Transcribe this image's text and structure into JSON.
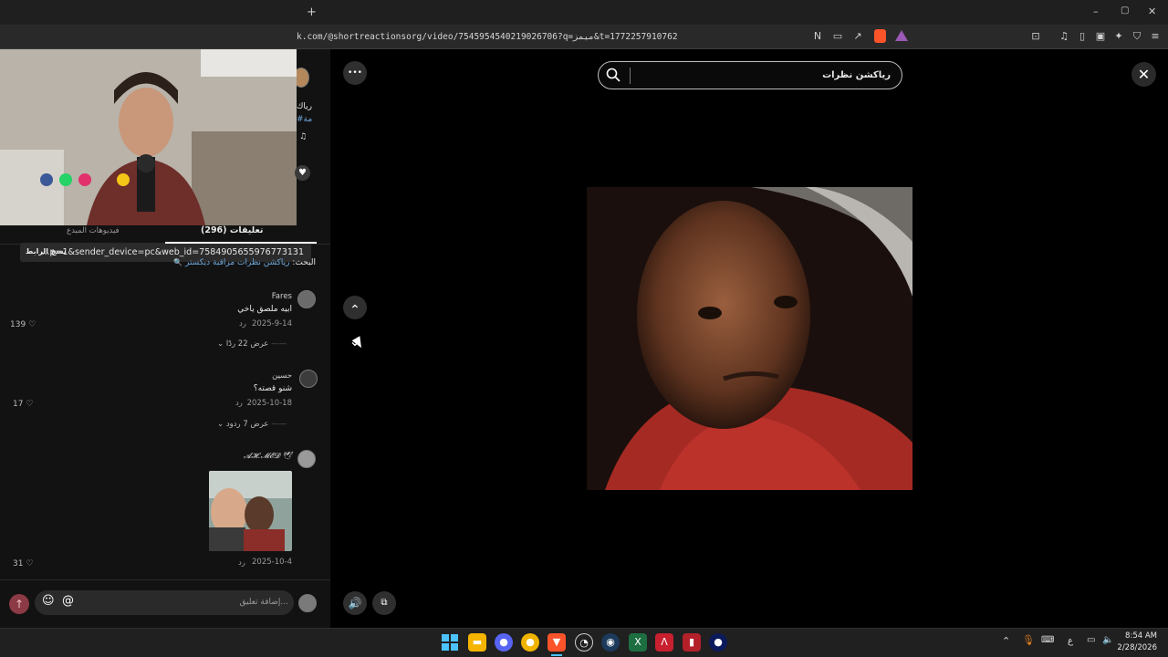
{
  "browser": {
    "new_tab_label": "+",
    "url": "k.com/@shortreactionsorg/video/7545954540219026706?q=ميمز&t=1772257910762",
    "window_controls": {
      "minimize": "–",
      "restore": "▢",
      "close": "✕"
    }
  },
  "left_panel": {
    "partial_caption_line1": "رياك",
    "partial_caption_line2": "#مة",
    "partial_music_icon": "♫",
    "share_link": "...p=1&sender_device=pc&web_id=7584905655976773131",
    "copy_link_label": "نسخ الرابط",
    "tabs": [
      {
        "label": "(296) تعليقات",
        "active": true
      },
      {
        "label": "فيديوهات المبدع",
        "active": false
      }
    ],
    "search_hint_prefix": "البحث:",
    "search_hint_query": "رياكشن نظرات مراقبة ديكستر",
    "comments": [
      {
        "user": "Fares",
        "text": "ابيه ملصق ياخي",
        "date": "2025-9-14",
        "reply_label": "رد",
        "likes": "139",
        "view_replies": "عرض 22 ردًا"
      },
      {
        "user": "حسين",
        "text": "شنو قصته؟",
        "date": "2025-10-18",
        "reply_label": "رد",
        "likes": "17",
        "view_replies": "عرض 7 ردود"
      },
      {
        "user": "𝓐𝓗.𝓜𝓔𝓓 🕊",
        "text": "",
        "date": "2025-10-4",
        "reply_label": "رد",
        "likes": "31",
        "view_replies": ""
      }
    ],
    "comment_placeholder": "إضافة تعليق...",
    "mention_symbol": "@",
    "emoji_symbol": "☺"
  },
  "video_area": {
    "search_value": "رياكشن نظرات",
    "more_icon": "•••",
    "up_icon": "⌃",
    "down_icon": "⌄"
  },
  "taskbar": {
    "time": "8:54 AM",
    "date": "2/28/2026",
    "input_lang": "ع"
  },
  "colors": {
    "accent_blue": "#6fa8dc",
    "tab_underline": "#ffffff",
    "send_button": "#8c3a45"
  }
}
